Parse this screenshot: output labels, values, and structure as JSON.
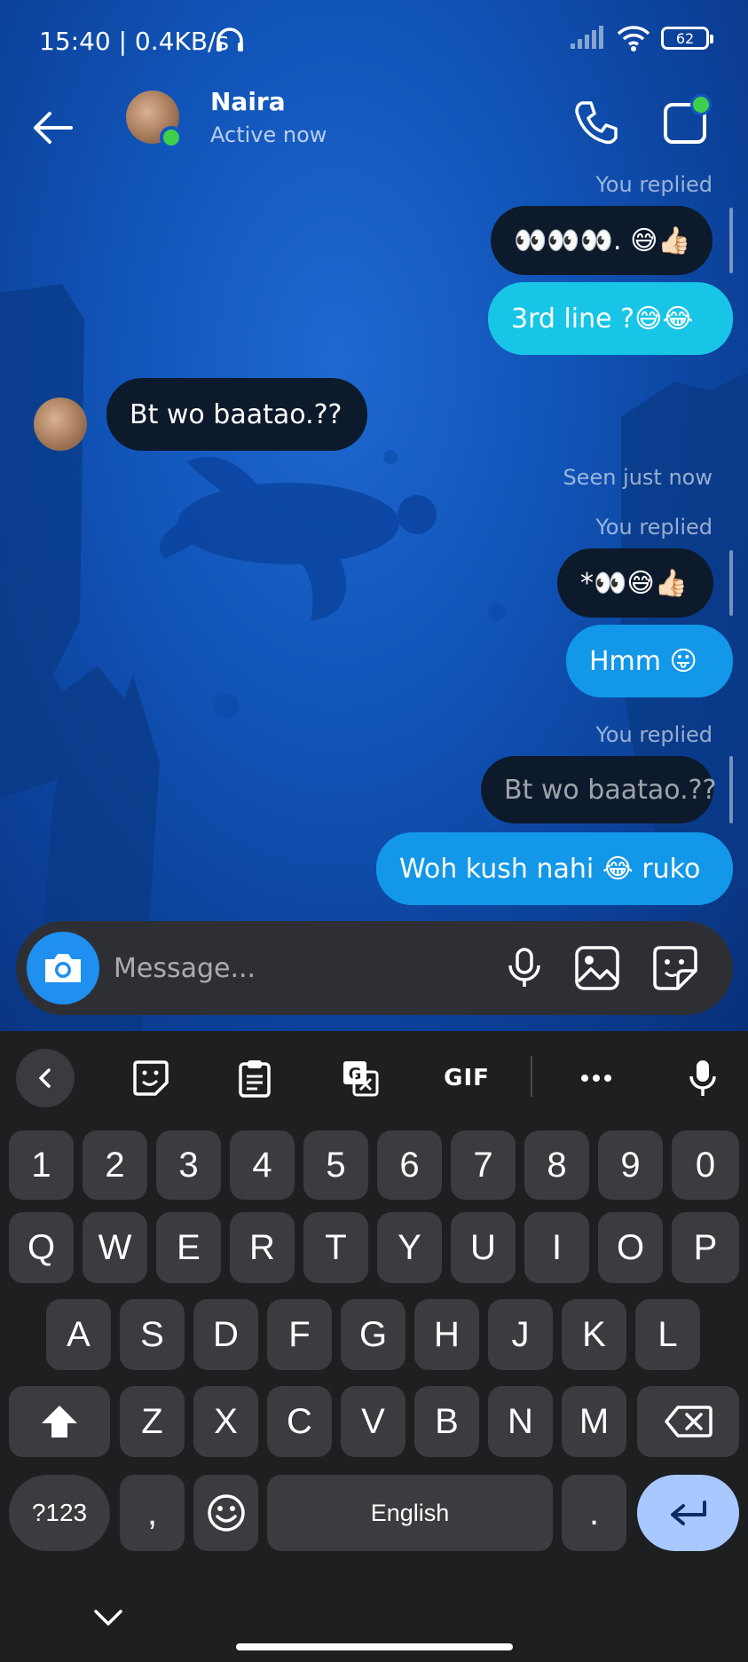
{
  "status_bar": {
    "time": "15:40 | 0.4KB/s",
    "battery": "62"
  },
  "header": {
    "contact_name": "Naira",
    "contact_status": "Active now"
  },
  "messages": [
    {
      "type": "meta",
      "text": "You replied"
    },
    {
      "type": "sent",
      "text": "👀👀👀. 😅👍🏻"
    },
    {
      "type": "sent",
      "text": "3rd line ?😅😂"
    },
    {
      "type": "received",
      "text": "Bt wo baatao.??"
    },
    {
      "type": "meta",
      "text": "Seen just now"
    },
    {
      "type": "meta",
      "text": "You replied"
    },
    {
      "type": "sent",
      "text": "*👀😅👍🏻"
    },
    {
      "type": "sent",
      "text": "Hmm 😛"
    },
    {
      "type": "meta",
      "text": "You replied"
    },
    {
      "type": "sent",
      "text": "Bt wo baatao.??"
    },
    {
      "type": "sent",
      "text": "Woh kush nahi 😂 ruko"
    }
  ],
  "composer": {
    "placeholder": "Message..."
  },
  "keyboard": {
    "toolbar_gif": "GIF",
    "row_numbers": [
      "1",
      "2",
      "3",
      "4",
      "5",
      "6",
      "7",
      "8",
      "9",
      "0"
    ],
    "row_1": [
      "Q",
      "W",
      "E",
      "R",
      "T",
      "Y",
      "U",
      "I",
      "O",
      "P"
    ],
    "row_2": [
      "A",
      "S",
      "D",
      "F",
      "G",
      "H",
      "J",
      "K",
      "L"
    ],
    "row_3": [
      "Z",
      "X",
      "C",
      "V",
      "B",
      "N",
      "M"
    ],
    "symbols_key": "?123",
    "comma_key": ",",
    "space_label": "English",
    "period_key": "."
  },
  "colors": {
    "chat_bg": "#1154b8",
    "bubble_dark": "#0d1a2c",
    "bubble_cyan": "#18c5e7",
    "bubble_blue": "#1397e8",
    "online_green": "#3fcf4a",
    "enter_key": "#a9c8ff"
  }
}
